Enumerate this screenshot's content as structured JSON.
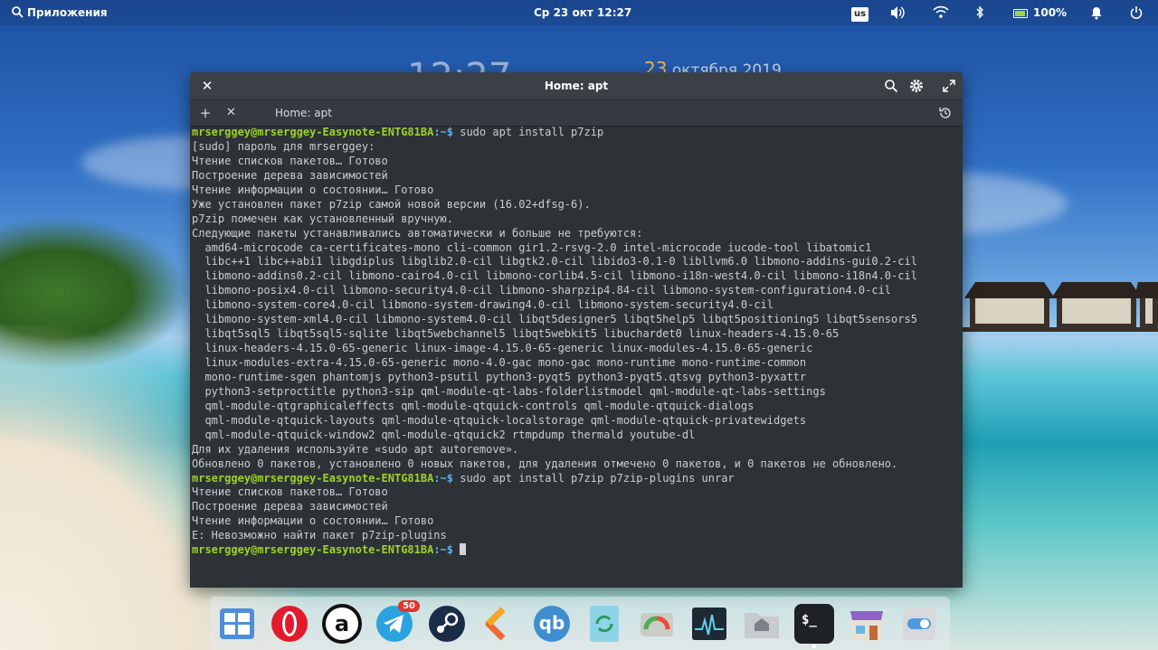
{
  "panel": {
    "apps_label": "Приложения",
    "date": "Ср 23 окт",
    "time": "12:27",
    "keyboard": "us",
    "battery": "100%"
  },
  "wallpaper_clock": {
    "day": "23",
    "month_year": "октября 2019"
  },
  "window": {
    "title": "Home: apt",
    "tab_label": "Home: apt"
  },
  "prompt": {
    "user": "mrserggey@mrserggey-Easynote-ENTG81BA",
    "path": ":~$"
  },
  "console": [
    {
      "prompt": true,
      "cmd": " sudo apt install p7zip"
    },
    {
      "text": "[sudo] пароль для mrserggey:"
    },
    {
      "text": "Чтение списков пакетов… Готово"
    },
    {
      "text": "Построение дерева зависимостей"
    },
    {
      "text": "Чтение информации о состоянии… Готово"
    },
    {
      "text": "Уже установлен пакет p7zip самой новой версии (16.02+dfsg-6)."
    },
    {
      "text": "p7zip помечен как установленный вручную."
    },
    {
      "text": "Следующие пакеты устанавливались автоматически и больше не требуются:"
    },
    {
      "text": "  amd64-microcode ca-certificates-mono cli-common gir1.2-rsvg-2.0 intel-microcode iucode-tool libatomic1"
    },
    {
      "text": "  libc++1 libc++abi1 libgdiplus libglib2.0-cil libgtk2.0-cil libido3-0.1-0 libllvm6.0 libmono-addins-gui0.2-cil"
    },
    {
      "text": "  libmono-addins0.2-cil libmono-cairo4.0-cil libmono-corlib4.5-cil libmono-i18n-west4.0-cil libmono-i18n4.0-cil"
    },
    {
      "text": "  libmono-posix4.0-cil libmono-security4.0-cil libmono-sharpzip4.84-cil libmono-system-configuration4.0-cil"
    },
    {
      "text": "  libmono-system-core4.0-cil libmono-system-drawing4.0-cil libmono-system-security4.0-cil"
    },
    {
      "text": "  libmono-system-xml4.0-cil libmono-system4.0-cil libqt5designer5 libqt5help5 libqt5positioning5 libqt5sensors5"
    },
    {
      "text": "  libqt5sql5 libqt5sql5-sqlite libqt5webchannel5 libqt5webkit5 libuchardet0 linux-headers-4.15.0-65"
    },
    {
      "text": "  linux-headers-4.15.0-65-generic linux-image-4.15.0-65-generic linux-modules-4.15.0-65-generic"
    },
    {
      "text": "  linux-modules-extra-4.15.0-65-generic mono-4.0-gac mono-gac mono-runtime mono-runtime-common"
    },
    {
      "text": "  mono-runtime-sgen phantomjs python3-psutil python3-pyqt5 python3-pyqt5.qtsvg python3-pyxattr"
    },
    {
      "text": "  python3-setproctitle python3-sip qml-module-qt-labs-folderlistmodel qml-module-qt-labs-settings"
    },
    {
      "text": "  qml-module-qtgraphicaleffects qml-module-qtquick-controls qml-module-qtquick-dialogs"
    },
    {
      "text": "  qml-module-qtquick-layouts qml-module-qtquick-localstorage qml-module-qtquick-privatewidgets"
    },
    {
      "text": "  qml-module-qtquick-window2 qml-module-qtquick2 rtmpdump thermald youtube-dl"
    },
    {
      "text": "Для их удаления используйте «sudo apt autoremove»."
    },
    {
      "text": "Обновлено 0 пакетов, установлено 0 новых пакетов, для удаления отмечено 0 пакетов, и 0 пакетов не обновлено."
    },
    {
      "prompt": true,
      "cmd": " sudo apt install p7zip p7zip-plugins unrar"
    },
    {
      "text": "Чтение списков пакетов… Готово"
    },
    {
      "text": "Построение дерева зависимостей"
    },
    {
      "text": "Чтение информации о состоянии… Готово"
    },
    {
      "text": "E: Невозможно найти пакет p7zip-plugins"
    },
    {
      "prompt": true,
      "cmd": " ",
      "cursor": true
    }
  ],
  "dock": {
    "telegram_badge": "50",
    "qbittorrent_label": "qb",
    "terminal_label": "$_"
  },
  "colors": {
    "prompt_user": "#9dd22a",
    "prompt_path": "#5ab3f0",
    "terminal_bg": "#2d3237",
    "terminal_fg": "#c9cdd1"
  }
}
